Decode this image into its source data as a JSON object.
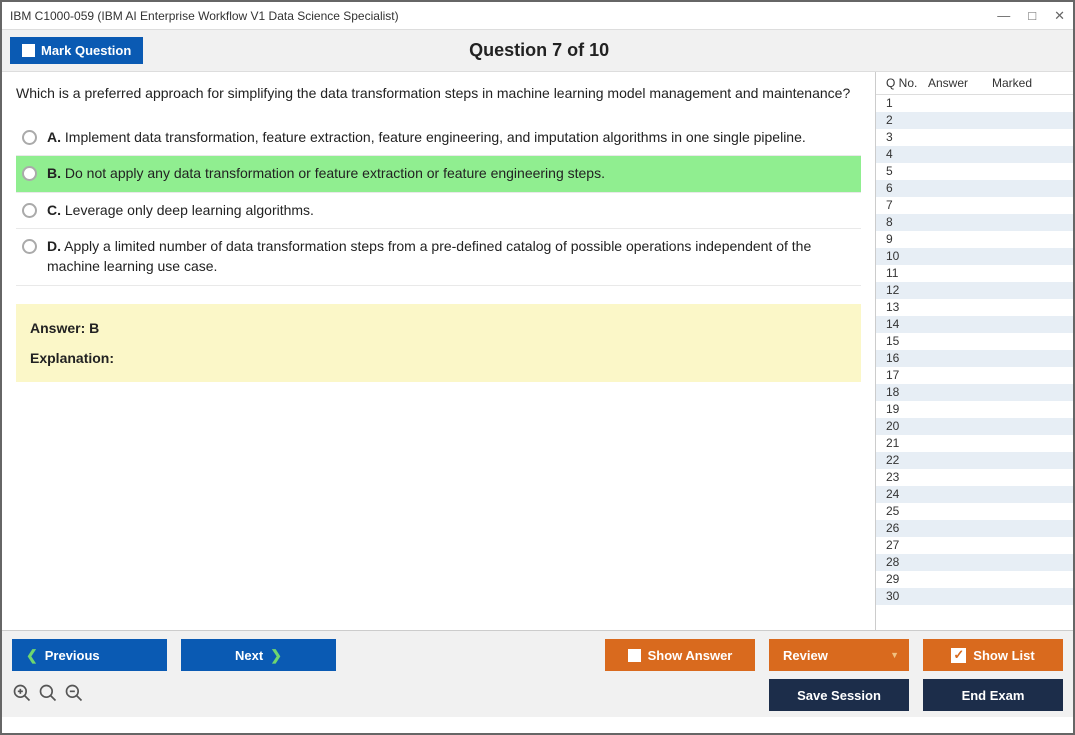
{
  "window": {
    "title": "IBM C1000-059 (IBM AI Enterprise Workflow V1 Data Science Specialist)"
  },
  "header": {
    "mark_label": "Mark Question",
    "question_title": "Question 7 of 10"
  },
  "question": {
    "text": "Which is a preferred approach for simplifying the data transformation steps in machine learning model management and maintenance?",
    "choices": [
      {
        "letter": "A.",
        "text": "Implement data transformation, feature extraction, feature engineering, and imputation algorithms in one single pipeline.",
        "selected": false
      },
      {
        "letter": "B.",
        "text": "Do not apply any data transformation or feature extraction or feature engineering steps.",
        "selected": true
      },
      {
        "letter": "C.",
        "text": "Leverage only deep learning algorithms.",
        "selected": false
      },
      {
        "letter": "D.",
        "text": "Apply a limited number of data transformation steps from a pre-defined catalog of possible operations independent of the machine learning use case.",
        "selected": false
      }
    ]
  },
  "answer": {
    "line": "Answer: B",
    "explanation_label": "Explanation:"
  },
  "sidebar": {
    "headers": {
      "q": "Q No.",
      "a": "Answer",
      "m": "Marked"
    },
    "rows": [
      {
        "n": "1"
      },
      {
        "n": "2"
      },
      {
        "n": "3"
      },
      {
        "n": "4"
      },
      {
        "n": "5"
      },
      {
        "n": "6"
      },
      {
        "n": "7"
      },
      {
        "n": "8"
      },
      {
        "n": "9"
      },
      {
        "n": "10"
      },
      {
        "n": "11"
      },
      {
        "n": "12"
      },
      {
        "n": "13"
      },
      {
        "n": "14"
      },
      {
        "n": "15"
      },
      {
        "n": "16"
      },
      {
        "n": "17"
      },
      {
        "n": "18"
      },
      {
        "n": "19"
      },
      {
        "n": "20"
      },
      {
        "n": "21"
      },
      {
        "n": "22"
      },
      {
        "n": "23"
      },
      {
        "n": "24"
      },
      {
        "n": "25"
      },
      {
        "n": "26"
      },
      {
        "n": "27"
      },
      {
        "n": "28"
      },
      {
        "n": "29"
      },
      {
        "n": "30"
      }
    ]
  },
  "footer": {
    "previous": "Previous",
    "next": "Next",
    "show_answer": "Show Answer",
    "review": "Review",
    "show_list": "Show List",
    "save_session": "Save Session",
    "end_exam": "End Exam"
  }
}
